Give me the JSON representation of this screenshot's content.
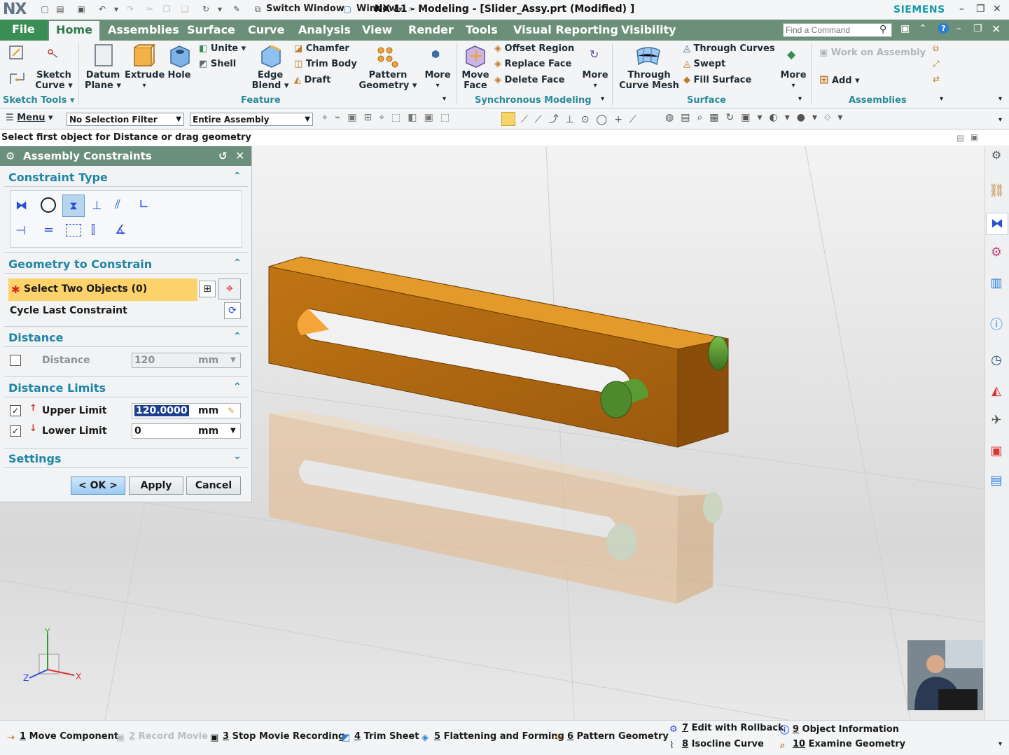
{
  "app": {
    "logo": "NX",
    "title": "NX 11 - Modeling - [Slider_Assy.prt (Modified) ]",
    "brand": "SIEMENS",
    "switch_window": "Switch Window",
    "window_menu": "Window"
  },
  "tabs": {
    "file": "File",
    "home": "Home",
    "items": [
      "Assemblies",
      "Surface",
      "Curve",
      "Analysis",
      "View",
      "Render",
      "Tools",
      "Visual Reporting",
      "Visibility"
    ]
  },
  "find_command": {
    "placeholder": "Find a Command"
  },
  "ribbon": {
    "sketch": "Sketch",
    "sketch_curve": "Curve",
    "sketch_tools": "Sketch Tools",
    "datum": "Datum",
    "datum_plane": "Plane",
    "extrude": "Extrude",
    "hole": "Hole",
    "unite": "Unite",
    "shell": "Shell",
    "edge": "Edge",
    "edge_blend": "Blend",
    "chamfer": "Chamfer",
    "trim_body": "Trim Body",
    "draft": "Draft",
    "pattern": "Pattern",
    "pattern_geometry": "Geometry",
    "more": "More",
    "feature": "Feature",
    "move": "Move",
    "move_face": "Face",
    "offset_region": "Offset Region",
    "replace_face": "Replace Face",
    "delete_face": "Delete Face",
    "sync_modeling": "Synchronous Modeling",
    "through": "Through",
    "curve_mesh": "Curve Mesh",
    "through_curves": "Through Curves",
    "swept": "Swept",
    "fill_surface": "Fill Surface",
    "surface": "Surface",
    "work_on_assembly": "Work on Assembly",
    "add": "Add",
    "assemblies": "Assemblies"
  },
  "selbar": {
    "menu": "Menu",
    "filter": "No Selection Filter",
    "scope": "Entire Assembly"
  },
  "cue": "Select first object for Distance or drag geometry",
  "dialog": {
    "title": "Assembly Constraints",
    "constraint_type": "Constraint Type",
    "geometry_to_constrain": "Geometry to Constrain",
    "select_two_objects": "Select Two Objects (0)",
    "cycle_last": "Cycle Last Constraint",
    "distance_header": "Distance",
    "distance_label": "Distance",
    "distance_value": "120",
    "distance_unit": "mm",
    "distance_limits": "Distance Limits",
    "upper_limit": "Upper Limit",
    "upper_value": "120.0000",
    "upper_unit": "mm",
    "lower_limit": "Lower Limit",
    "lower_value": "0",
    "lower_unit": "mm",
    "settings": "Settings",
    "ok": "< OK >",
    "apply": "Apply",
    "cancel": "Cancel"
  },
  "triad": {
    "x": "X",
    "y": "Y",
    "z": "Z"
  },
  "statusbar": {
    "items": [
      {
        "num": "1",
        "label": "Move Component",
        "enabled": true
      },
      {
        "num": "2",
        "label": "Record Movie",
        "enabled": false
      },
      {
        "num": "3",
        "label": "Stop Movie Recording",
        "enabled": true
      },
      {
        "num": "4",
        "label": "Trim Sheet",
        "enabled": true
      },
      {
        "num": "5",
        "label": "Flattening and Forming",
        "enabled": true
      },
      {
        "num": "6",
        "label": "Pattern Geometry",
        "enabled": true
      },
      {
        "num": "7",
        "label": "Edit with Rollback",
        "enabled": true
      },
      {
        "num": "8",
        "label": "Isocline Curve",
        "enabled": true
      },
      {
        "num": "9",
        "label": "Object Information",
        "enabled": true
      },
      {
        "num": "10",
        "label": "Examine Geometry",
        "enabled": true
      }
    ]
  },
  "colors": {
    "tabbar": "#6b8f78",
    "file_tab": "#3b8d56",
    "accent_teal": "#1f86a6",
    "required_highlight": "#fcd36a",
    "part": "#b3650e",
    "pin": "#4f8f2f"
  }
}
